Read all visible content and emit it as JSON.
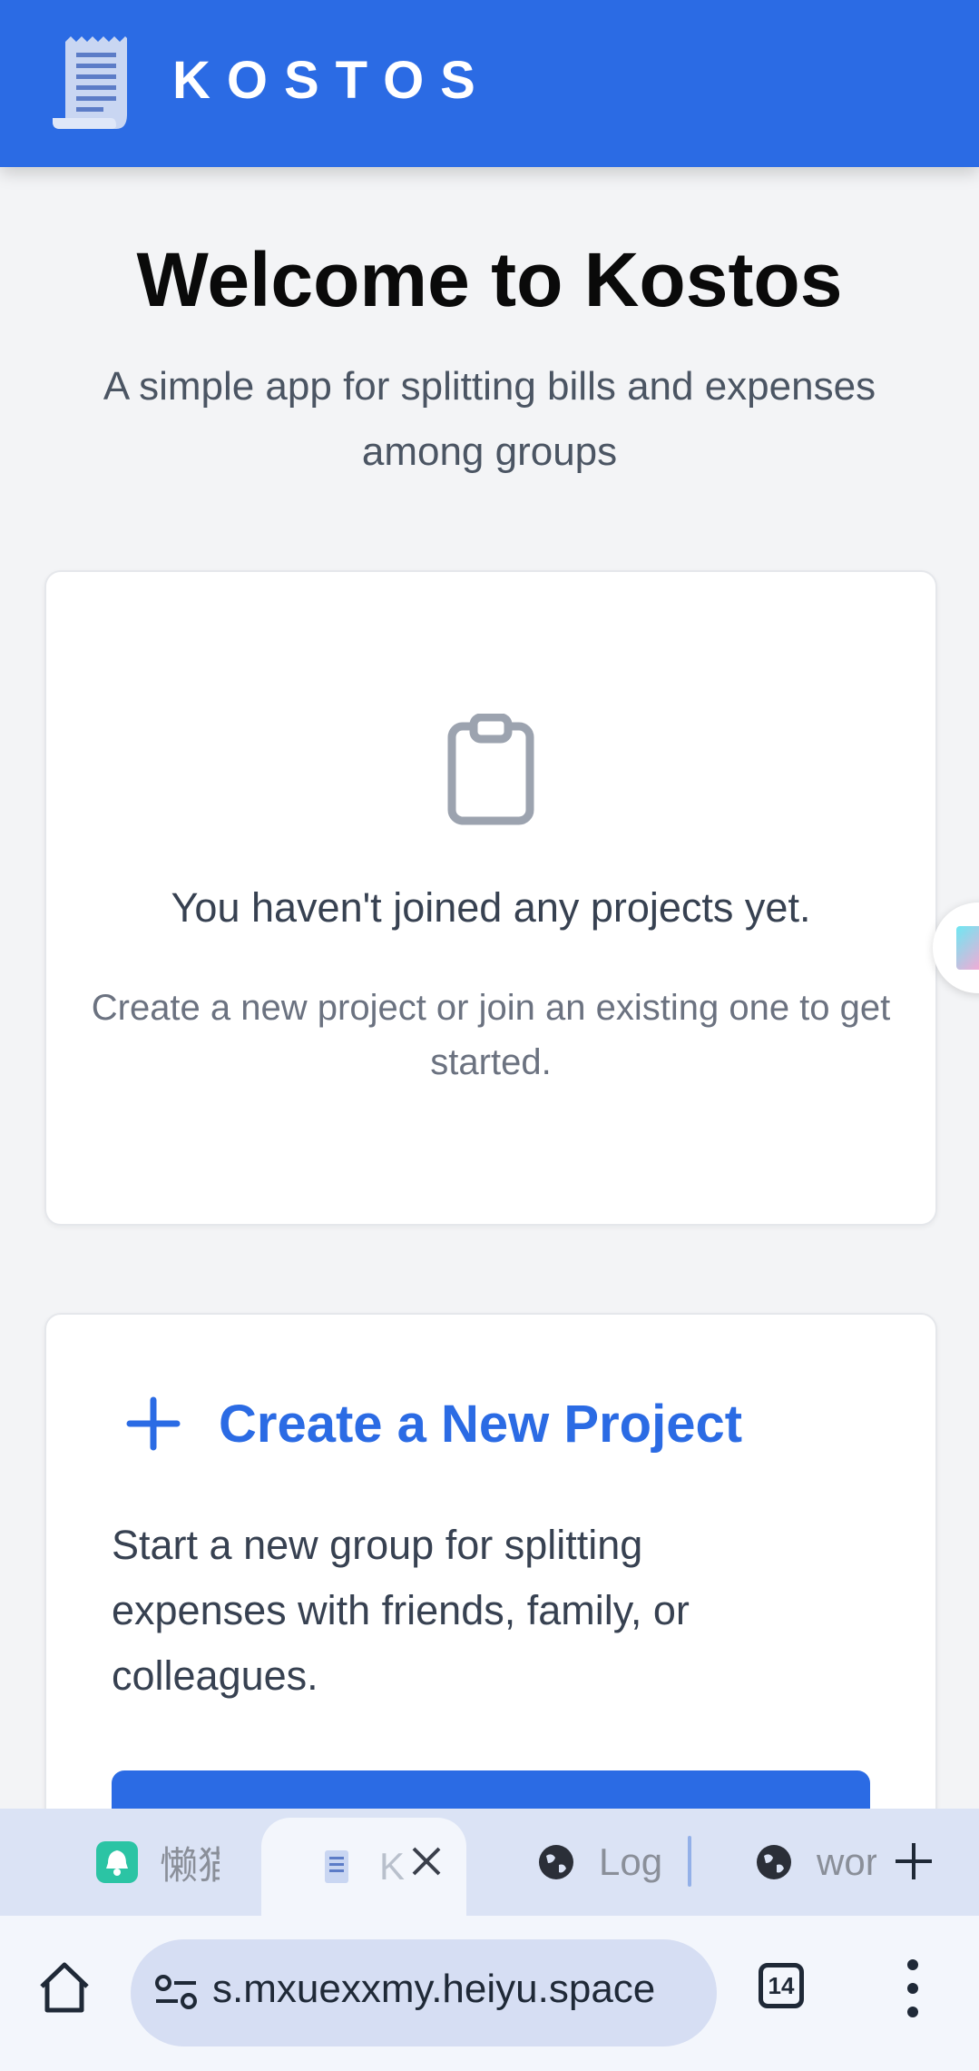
{
  "header": {
    "brand": "KOSTOS",
    "logo_icon": "receipt-icon",
    "background": "#2b6be4"
  },
  "welcome": {
    "title": "Welcome to Kostos",
    "subtitle": "A simple app for splitting bills and expenses among groups"
  },
  "empty_state": {
    "icon": "clipboard-icon",
    "title": "You haven't joined any projects yet.",
    "description": "Create a new project or join an existing one to get started."
  },
  "create_project": {
    "icon": "plus-icon",
    "title": "Create a New Project",
    "description": "Start a new group for splitting expenses with friends, family, or colleagues.",
    "accent": "#2b6be4"
  },
  "browser": {
    "tabs": [
      {
        "label": "懒猫",
        "icon": "bell-app-icon"
      },
      {
        "label": "K",
        "icon": "receipt-icon",
        "active": true
      },
      {
        "label": "Log",
        "icon": "globe-icon"
      },
      {
        "label": "wor",
        "icon": "globe-icon"
      }
    ],
    "url": "s.mxuexxmy.heiyu.space",
    "tab_count": "14"
  }
}
